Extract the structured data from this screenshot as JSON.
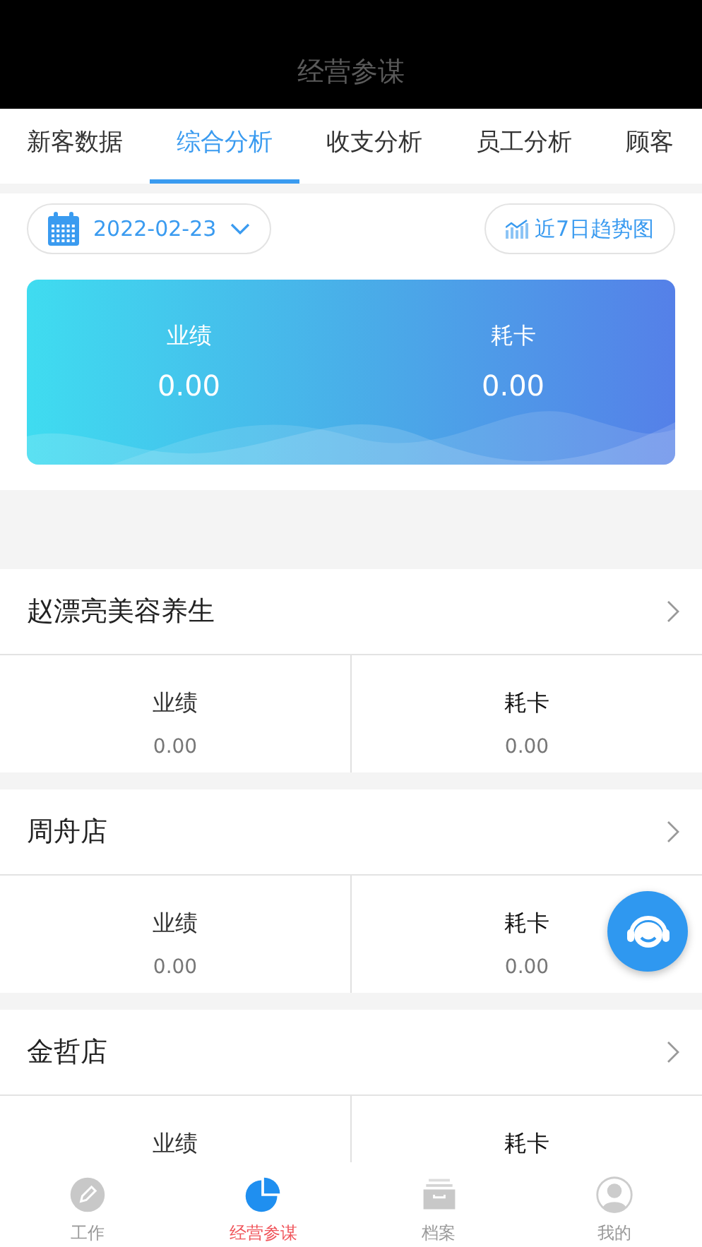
{
  "header": {
    "title": "经营参谋"
  },
  "tabs": [
    {
      "label": "新客数据",
      "selected": false
    },
    {
      "label": "综合分析",
      "selected": true
    },
    {
      "label": "收支分析",
      "selected": false
    },
    {
      "label": "员工分析",
      "selected": false
    },
    {
      "label": "顾客",
      "selected": false
    }
  ],
  "date_picker": {
    "value": "2022-02-23"
  },
  "trend_button": {
    "label": "近7日趋势图"
  },
  "summary": [
    {
      "label": "业绩",
      "value": "0.00"
    },
    {
      "label": "耗卡",
      "value": "0.00"
    }
  ],
  "stores": [
    {
      "name": "赵漂亮美容养生",
      "metrics": [
        {
          "label": "业绩",
          "value": "0.00"
        },
        {
          "label": "耗卡",
          "value": "0.00"
        }
      ]
    },
    {
      "name": "周舟店",
      "metrics": [
        {
          "label": "业绩",
          "value": "0.00"
        },
        {
          "label": "耗卡",
          "value": "0.00"
        }
      ]
    },
    {
      "name": "金哲店",
      "metrics": [
        {
          "label": "业绩"
        },
        {
          "label": "耗卡"
        }
      ]
    }
  ],
  "bottom_nav": [
    {
      "label": "工作",
      "kind": "pencil",
      "selected": false
    },
    {
      "label": "经营参谋",
      "kind": "pie",
      "selected": true
    },
    {
      "label": "档案",
      "kind": "archive",
      "selected": false
    },
    {
      "label": "我的",
      "kind": "person",
      "selected": false
    }
  ]
}
